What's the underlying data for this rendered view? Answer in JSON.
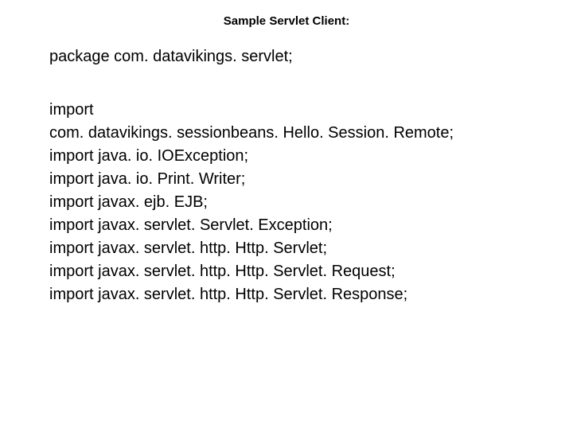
{
  "heading": "Sample Servlet Client:",
  "package_line": "package com. datavikings. servlet;",
  "import_lines": [
    "import",
    "com. datavikings. sessionbeans. Hello. Session. Remote;",
    "import java. io. IOException;",
    "import java. io. Print. Writer;",
    "import javax. ejb. EJB;",
    "import javax. servlet. Servlet. Exception;",
    "import javax. servlet. http. Http. Servlet;",
    "import javax. servlet. http. Http. Servlet. Request;",
    "import javax. servlet. http. Http. Servlet. Response;"
  ]
}
